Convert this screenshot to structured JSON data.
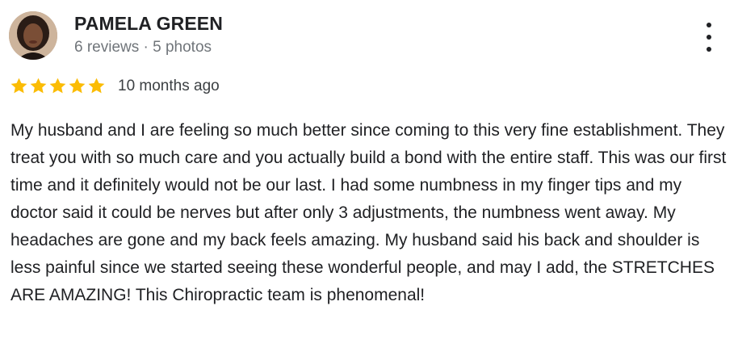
{
  "review": {
    "author": {
      "name": "PAMELA GREEN",
      "meta": "6 reviews · 5 photos",
      "avatar_icon": "profile-photo"
    },
    "rating": {
      "stars": 5,
      "max": 5,
      "star_color": "#fbbc04"
    },
    "time": "10 months ago",
    "text": "My husband and I are feeling so much better since coming to this very fine establishment. They treat you with so much care and you actually build a bond with the entire staff. This was our first time and it definitely would not be our last. I had some numbness in my finger tips and my doctor said it could be nerves but after only 3 adjustments, the numbness went away. My headaches are gone and my back feels amazing. My husband said his back and shoulder is less painful since we started seeing these wonderful people, and may I add, the STRETCHES ARE AMAZING! This Chiropractic team is phenomenal!",
    "more_icon": "more-vert-icon"
  }
}
